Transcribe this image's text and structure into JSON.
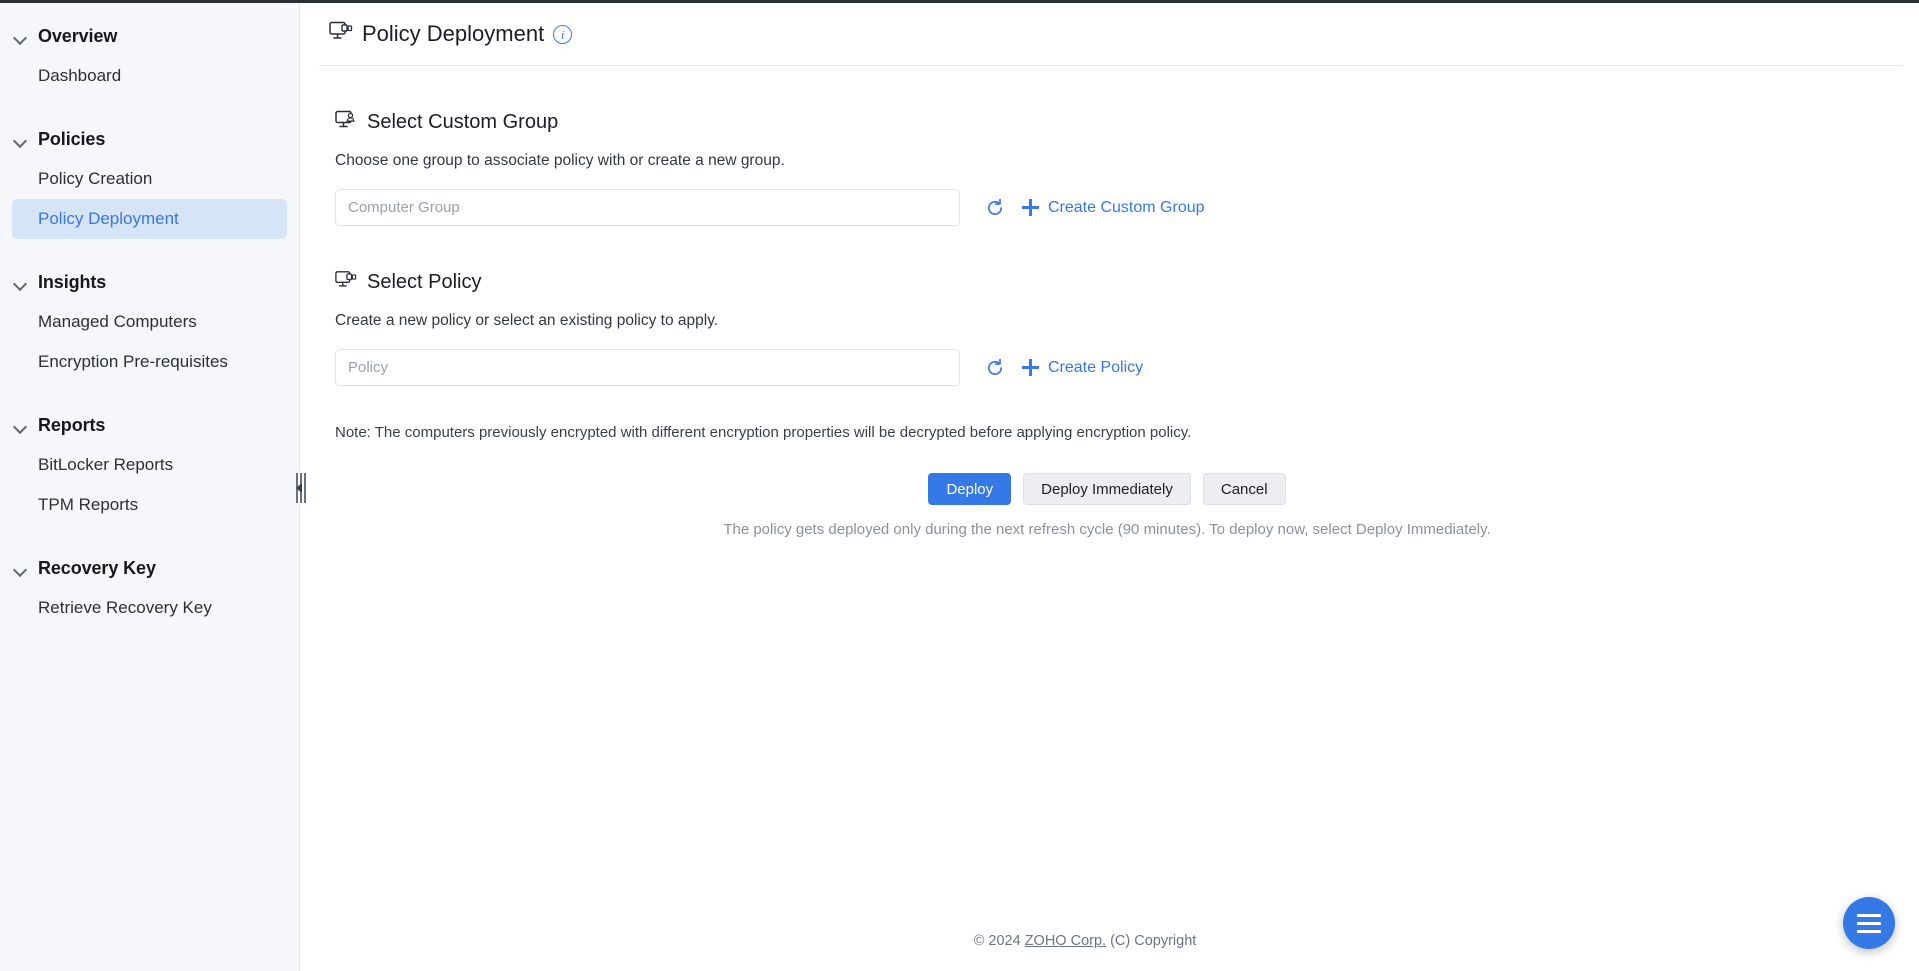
{
  "sidebar": {
    "groups": [
      {
        "label": "Overview",
        "icon": "chevron-down-icon",
        "items": [
          {
            "label": "Dashboard",
            "active": false
          }
        ]
      },
      {
        "label": "Policies",
        "icon": "chevron-down-icon",
        "items": [
          {
            "label": "Policy Creation",
            "active": false
          },
          {
            "label": "Policy Deployment",
            "active": true
          }
        ]
      },
      {
        "label": "Insights",
        "icon": "chevron-down-icon",
        "items": [
          {
            "label": "Managed Computers",
            "active": false
          },
          {
            "label": "Encryption Pre-requisites",
            "active": false
          }
        ]
      },
      {
        "label": "Reports",
        "icon": "chevron-down-icon",
        "items": [
          {
            "label": "BitLocker Reports",
            "active": false
          },
          {
            "label": "TPM Reports",
            "active": false
          }
        ]
      },
      {
        "label": "Recovery Key",
        "icon": "chevron-down-icon",
        "items": [
          {
            "label": "Retrieve Recovery Key",
            "active": false
          }
        ]
      }
    ]
  },
  "header": {
    "icon": "computer-policy-icon",
    "title": "Policy Deployment",
    "info_icon": "info-icon",
    "info_icon_label": "i"
  },
  "custom_group_section": {
    "icon": "computer-group-icon",
    "title": "Select Custom Group",
    "subtitle": "Choose one group to associate policy with or create a new group.",
    "input_placeholder": "Computer Group",
    "input_value": "",
    "refresh_icon": "refresh-icon",
    "create_icon": "plus-icon",
    "create_label": "Create Custom Group"
  },
  "policy_section": {
    "icon": "computer-policy-icon",
    "title": "Select Policy",
    "subtitle": "Create a new policy or select an existing policy to apply.",
    "input_placeholder": "Policy",
    "input_value": "",
    "refresh_icon": "refresh-icon",
    "create_icon": "plus-icon",
    "create_label": "Create Policy"
  },
  "note": "Note: The computers previously encrypted with different encryption properties will be decrypted before applying encryption policy.",
  "actions": {
    "deploy_label": "Deploy",
    "deploy_immediately_label": "Deploy Immediately",
    "cancel_label": "Cancel",
    "hint": "The policy gets deployed only during the next refresh cycle (90 minutes). To deploy now, select Deploy Immediately."
  },
  "footer": {
    "prefix": "© 2024 ",
    "link": "ZOHO Corp.",
    "suffix": " (C) Copyright"
  },
  "fab": {
    "icon": "hamburger-menu-icon"
  },
  "colors": {
    "accent": "#3579e6",
    "sidebar_bg": "#f5f7fa",
    "active_item_bg": "#d6e4f7",
    "muted_text": "#8b9099",
    "top_strip": "#2b2f3a"
  }
}
